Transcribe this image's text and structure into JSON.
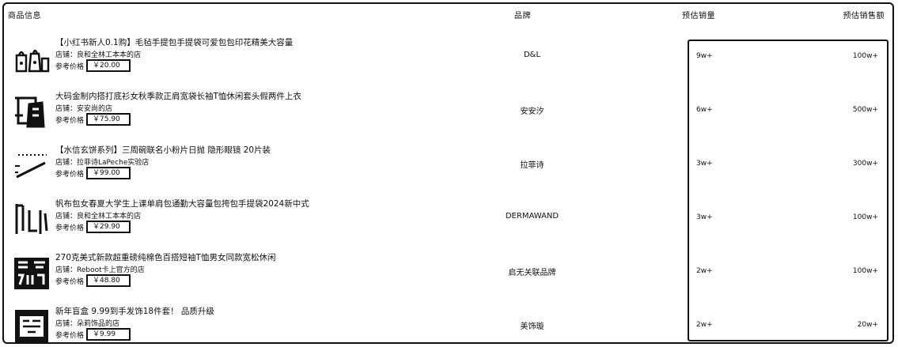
{
  "table": {
    "headers": {
      "product": "商品信息",
      "brand": "品牌",
      "sales": "预估销量",
      "revenue": "预估销售额"
    },
    "shop_prefix": "店铺：",
    "price_prefix": "参考价格",
    "rows": [
      {
        "title": "【小红书新人0.1购】毛毡手提包手提袋可爱包包印花精美大容量",
        "shop": "良和全林工本本的店",
        "price": "￥20.00",
        "brand": "D&L",
        "sales": "9w+",
        "revenue": "100w+",
        "thumb_icon": "bags-product-icon"
      },
      {
        "title": "大码金制内搭打底衫女秋季款正肩宽袋长袖T恤休闲套头假两件上衣",
        "shop": "安安尚的店",
        "price": "￥75.90",
        "brand": "安安汐",
        "sales": "6w+",
        "revenue": "500w+",
        "thumb_icon": "shirt-product-icon"
      },
      {
        "title": "【水信玄饼系列】三周碗联名小粉片日抛 隐形眼镜 20片装",
        "shop": "拉菲诗LaPeche实验店",
        "price": "￥99.00",
        "brand": "拉菲诗",
        "sales": "3w+",
        "revenue": "300w+",
        "thumb_icon": "lens-product-icon"
      },
      {
        "title": "帆布包女春夏大学生上课单肩包通勤大容量包挎包手提袋2024新中式",
        "shop": "良和全林工本本的店",
        "price": "￥29.90",
        "brand": "DERMAWAND",
        "sales": "3w+",
        "revenue": "100w+",
        "thumb_icon": "canvas-bag-product-icon"
      },
      {
        "title": "270克美式新款超重磅纯棉色百搭短袖T恤男女同款宽松休闲",
        "shop": "Reboot卡上官方的店",
        "price": "￥48.80",
        "brand": "启无关联品牌",
        "sales": "2w+",
        "revenue": "100w+",
        "thumb_icon": "tshirt-product-icon"
      },
      {
        "title": "新年盲盒 9.99到手发饰18件套！ 品质升级",
        "shop": "朵莉饰品的店",
        "price": "￥9.99",
        "brand": "美饰璇",
        "sales": "2w+",
        "revenue": "20w+",
        "thumb_icon": "blindbox-product-icon"
      }
    ]
  },
  "colors": {
    "ink": "#111111",
    "background": "#ffffff"
  }
}
